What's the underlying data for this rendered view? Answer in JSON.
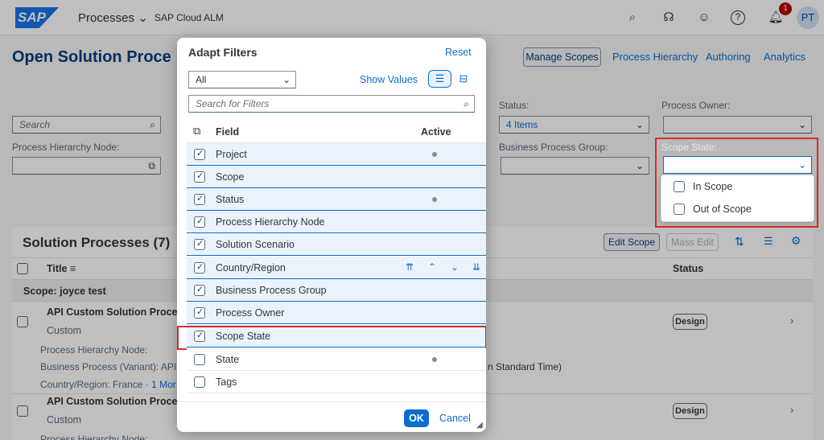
{
  "shell": {
    "logo": "SAP",
    "title": "Processes",
    "subtitle": "SAP Cloud ALM",
    "notifications": "1",
    "avatar": "PT"
  },
  "header": {
    "title": "Open Solution Proce",
    "manage_scopes": "Manage Scopes",
    "links": [
      "Process Hierarchy",
      "Authoring",
      "Analytics"
    ]
  },
  "filters": {
    "search_placeholder": "Search",
    "hierarchy_label": "Process Hierarchy Node:",
    "status_label": "Status:",
    "status_value": "4 Items",
    "bpg_label": "Business Process Group:",
    "owner_label": "Process Owner:",
    "scope_state_label": "Scope State:",
    "scope_state_options": [
      "In Scope",
      "Out of Scope"
    ]
  },
  "table": {
    "title": "Solution Processes (7)",
    "edit_scope": "Edit Scope",
    "mass_edit": "Mass Edit",
    "col_title": "Title",
    "col_status": "Status",
    "group": "Scope: joyce test",
    "rows": [
      {
        "title": "API Custom Solution Proces",
        "sub": "Custom",
        "status": "Design"
      },
      {
        "title": "API Custom Solution Proces",
        "sub": "Custom",
        "status": "Design"
      }
    ],
    "meta": {
      "hierarchy": "Process Hierarchy Node:",
      "bp": "Business Process (Variant):  API",
      "country": "Country/Region:  France · ",
      "more": "1 Mor",
      "tz": "n Standard Time)",
      "hierarchy2": "Process Hierarchy Node:"
    }
  },
  "dialog": {
    "title": "Adapt Filters",
    "reset": "Reset",
    "view_select": "All",
    "show_values": "Show Values",
    "search_placeholder": "Search for Filters",
    "col_field": "Field",
    "col_active": "Active",
    "fields": [
      {
        "label": "Project",
        "checked": true,
        "active": true
      },
      {
        "label": "Scope",
        "checked": true,
        "active": false
      },
      {
        "label": "Status",
        "checked": true,
        "active": true
      },
      {
        "label": "Process Hierarchy Node",
        "checked": true,
        "active": false
      },
      {
        "label": "Solution Scenario",
        "checked": true,
        "active": false
      },
      {
        "label": "Country/Region",
        "checked": true,
        "active": false
      },
      {
        "label": "Business Process Group",
        "checked": true,
        "active": false
      },
      {
        "label": "Process Owner",
        "checked": true,
        "active": false
      },
      {
        "label": "Scope State",
        "checked": true,
        "active": false
      },
      {
        "label": "State",
        "checked": false,
        "active": true
      },
      {
        "label": "Tags",
        "checked": false,
        "active": false
      }
    ],
    "ok": "OK",
    "cancel": "Cancel"
  }
}
